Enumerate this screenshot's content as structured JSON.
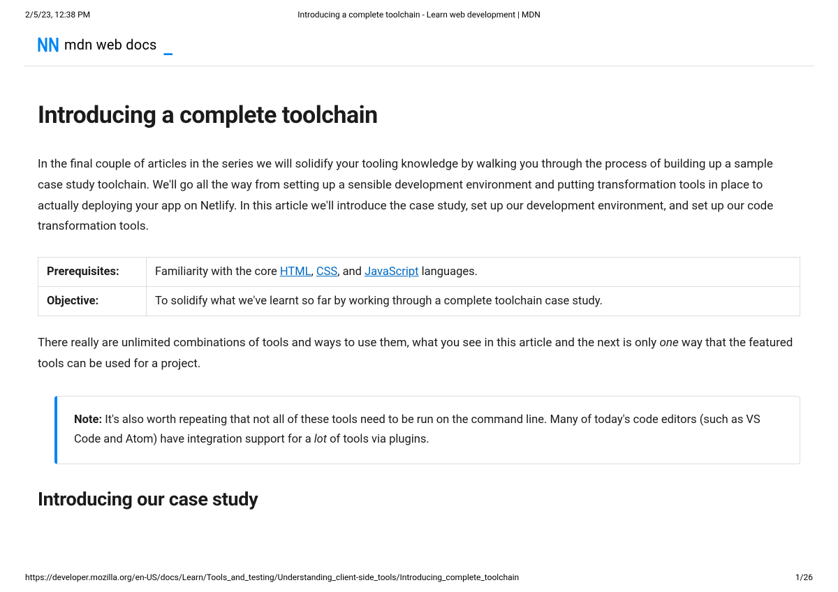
{
  "print_header": {
    "timestamp": "2/5/23, 12:38 PM",
    "title": "Introducing a complete toolchain - Learn web development | MDN"
  },
  "brand": {
    "text": "mdn web docs"
  },
  "page": {
    "title": "Introducing a complete toolchain",
    "intro": "In the final couple of articles in the series we will solidify your tooling knowledge by walking you through the process of building up a sample case study toolchain. We'll go all the way from setting up a sensible development environment and putting transformation tools in place to actually deploying your app on Netlify. In this article we'll introduce the case study, set up our development environment, and set up our code transformation tools."
  },
  "table": {
    "prereq_label": "Prerequisites:",
    "prereq_before": "Familiarity with the core ",
    "prereq_link_html": "HTML",
    "prereq_sep1": ", ",
    "prereq_link_css": "CSS",
    "prereq_sep2": ", and ",
    "prereq_link_js": "JavaScript",
    "prereq_after": " languages.",
    "objective_label": "Objective:",
    "objective_value": "To solidify what we've learnt so far by working through a complete toolchain case study."
  },
  "body": {
    "p1_before": "There really are unlimited combinations of tools and ways to use them, what you see in this article and the next is only ",
    "p1_italic": "one",
    "p1_after": " way that the featured tools can be used for a project."
  },
  "note": {
    "label": "Note:",
    "before": " It's also worth repeating that not all of these tools need to be run on the command line. Many of today's code editors (such as VS Code and Atom) have integration support for a ",
    "italic": "lot",
    "after": " of tools via plugins."
  },
  "section2": {
    "title": "Introducing our case study"
  },
  "print_footer": {
    "url": "https://developer.mozilla.org/en-US/docs/Learn/Tools_and_testing/Understanding_client-side_tools/Introducing_complete_toolchain",
    "page": "1/26"
  }
}
